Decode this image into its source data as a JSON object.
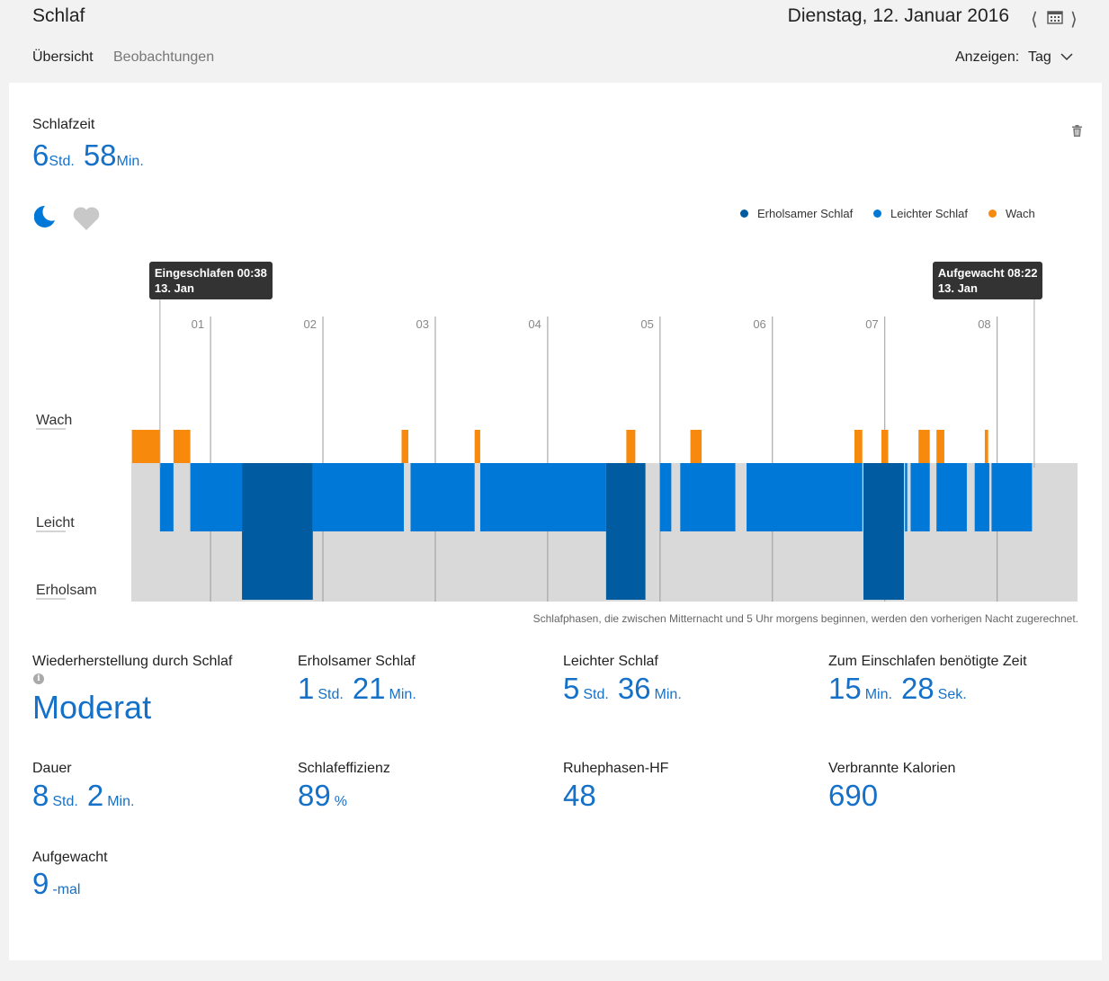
{
  "header": {
    "title": "Schlaf",
    "date": "Dienstag, 12. Januar 2016",
    "prev_icon": "chevron-left-icon",
    "calendar_icon": "calendar-icon",
    "next_icon": "chevron-right-icon"
  },
  "tabs": [
    {
      "label": "Übersicht",
      "active": true
    },
    {
      "label": "Beobachtungen",
      "active": false
    }
  ],
  "view": {
    "label": "Anzeigen:",
    "value": "Tag"
  },
  "sleep_time": {
    "label": "Schlafzeit",
    "hours": "6",
    "hours_unit": "Std.",
    "minutes": "58",
    "minutes_unit": "Min."
  },
  "icons": {
    "moon": "moon-icon",
    "heart": "heart-icon",
    "trash": "trash-icon"
  },
  "legend": [
    {
      "label": "Erholsamer Schlaf",
      "color": "#005ba1"
    },
    {
      "label": "Leichter Schlaf",
      "color": "#0078d7"
    },
    {
      "label": "Wach",
      "color": "#f7890c"
    }
  ],
  "tooltips": {
    "start_line1": "Eingeschlafen 00:38",
    "start_line2": "13. Jan",
    "end_line1": "Aufgewacht 08:22",
    "end_line2": "13. Jan"
  },
  "footnote": "Schlafphasen, die zwischen Mitternacht und 5 Uhr morgens beginnen, werden den vorherigen Nacht zugerechnet.",
  "chart_data": {
    "type": "timeline",
    "title": "",
    "x_unit": "hour of night",
    "x_range": [
      0.295,
      8.715
    ],
    "x_ticks": [
      "01",
      "02",
      "03",
      "04",
      "05",
      "06",
      "07",
      "08"
    ],
    "x_tick_values": [
      1,
      2,
      3,
      4,
      5,
      6,
      7,
      8
    ],
    "y_levels": [
      "Wach",
      "Leicht",
      "Erholsam"
    ],
    "series": [
      {
        "name": "Wach",
        "color": "#f7890c",
        "segments": [
          [
            0.3,
            0.55
          ],
          [
            0.67,
            0.82
          ],
          [
            2.7,
            2.76
          ],
          [
            3.35,
            3.4
          ],
          [
            4.7,
            4.78
          ],
          [
            5.27,
            5.37
          ],
          [
            6.73,
            6.8
          ],
          [
            6.97,
            7.03
          ],
          [
            7.3,
            7.4
          ],
          [
            7.46,
            7.53
          ],
          [
            7.89,
            7.92
          ]
        ]
      },
      {
        "name": "Leichter Schlaf",
        "color": "#0078d7",
        "segments": [
          [
            0.55,
            0.67
          ],
          [
            0.82,
            1.28
          ],
          [
            1.91,
            2.72
          ],
          [
            2.78,
            3.35
          ],
          [
            3.4,
            4.52
          ],
          [
            5.0,
            5.1
          ],
          [
            5.18,
            5.67
          ],
          [
            5.77,
            6.8
          ],
          [
            7.18,
            7.2
          ],
          [
            7.23,
            7.4
          ],
          [
            7.46,
            7.73
          ],
          [
            7.8,
            7.93
          ],
          [
            7.95,
            8.31
          ]
        ]
      },
      {
        "name": "Erholsamer Schlaf",
        "color": "#005ba1",
        "segments": [
          [
            1.28,
            1.91
          ],
          [
            4.52,
            4.87
          ],
          [
            6.81,
            7.17
          ]
        ]
      }
    ],
    "markers": [
      {
        "label": "Eingeschlafen 00:38",
        "x": 0.55
      },
      {
        "label": "Aufgewacht 08:22",
        "x": 8.33
      }
    ]
  },
  "stats": [
    {
      "label": "Wiederherstellung durch Schlaf",
      "text": "Moderat"
    },
    {
      "label": "Erholsamer Schlaf",
      "v1": "1",
      "u1": "Std.",
      "v2": "21",
      "u2": "Min."
    },
    {
      "label": "Leichter Schlaf",
      "v1": "5",
      "u1": "Std.",
      "v2": "36",
      "u2": "Min."
    },
    {
      "label": "Zum Einschlafen benötigte Zeit",
      "v1": "15",
      "u1": "Min.",
      "v2": "28",
      "u2": "Sek."
    },
    {
      "label": "Dauer",
      "v1": "8",
      "u1": "Std.",
      "v2": "2",
      "u2": "Min."
    },
    {
      "label": "Schlafeffizienz",
      "v1": "89",
      "u1": "%"
    },
    {
      "label": "Ruhephasen-HF",
      "v1": "48"
    },
    {
      "label": "Verbrannte Kalorien",
      "v1": "690"
    },
    {
      "label": "Aufgewacht",
      "v1": "9",
      "u1": "-mal"
    }
  ],
  "info_icon": "i"
}
